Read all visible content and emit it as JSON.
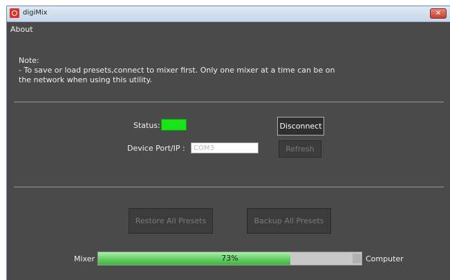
{
  "window": {
    "title": "digiMix",
    "close_icon": "close-icon",
    "app_icon": "app-icon"
  },
  "menu": {
    "about": "About"
  },
  "note": {
    "heading": "Note:",
    "line1": "- To save or load presets,connect to mixer first. Only one mixer at a time can be on",
    "line2": "the network when using this utility."
  },
  "connection": {
    "status_label": "Status:",
    "status_color": "#19e319",
    "port_label": "Device Port/IP :",
    "port_value": "COM3",
    "disconnect_label": "Disconnect",
    "refresh_label": "Refresh"
  },
  "presets": {
    "restore_label": "Restore All Presets",
    "backup_label": "Backup All Presets"
  },
  "transfer": {
    "left_label": "Mixer",
    "right_label": "Computer",
    "progress_text": "73%",
    "progress_value": 0.73
  }
}
